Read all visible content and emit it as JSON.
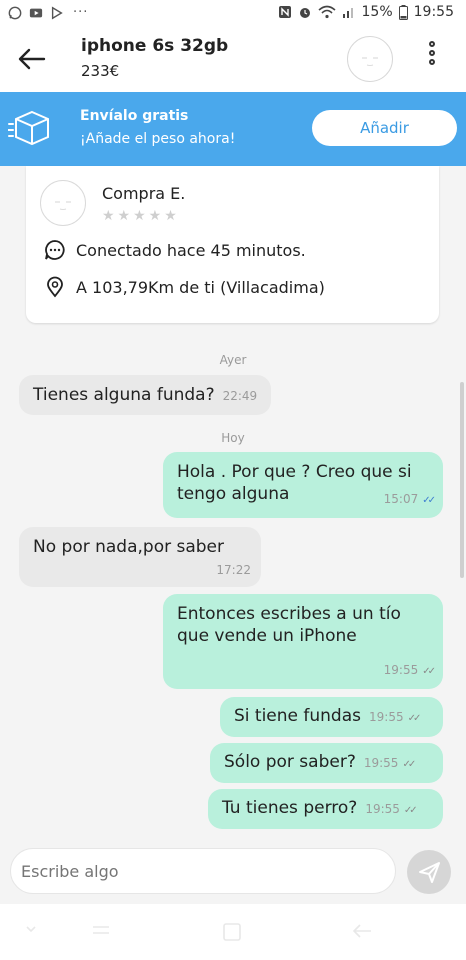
{
  "status_bar": {
    "notifications": [
      "whatsapp-icon",
      "youtube-icon",
      "play-store-icon"
    ],
    "more": "···",
    "battery": "15%",
    "time": "19:55"
  },
  "header": {
    "title": "iphone 6s 32gb",
    "price": "233€"
  },
  "banner": {
    "title": "Envíalo gratis",
    "subtitle": "¡Añade el peso ahora!",
    "button": "Añadir",
    "color": "#4aa8ec"
  },
  "seller": {
    "name": "Compra E.",
    "stars": "★★★★★",
    "last_seen": "Conectado hace 45 minutos.",
    "location": "A 103,79Km de ti (Villacadima)"
  },
  "chat": {
    "day_yesterday": "Ayer",
    "day_today": "Hoy",
    "messages": [
      {
        "text": "Tienes alguna funda?",
        "time": "22:49",
        "dir": "in"
      },
      {
        "text": "Hola . Por que ? Creo que si tengo alguna",
        "time": "15:07",
        "dir": "out"
      },
      {
        "text": "No por nada,por saber",
        "time": "17:22",
        "dir": "in"
      },
      {
        "text": "Entonces escribes a un tío que vende un iPhone",
        "time": "19:55",
        "dir": "out"
      },
      {
        "text": "Si tiene fundas",
        "time": "19:55",
        "dir": "out"
      },
      {
        "text": "Sólo por saber?",
        "time": "19:55",
        "dir": "out"
      },
      {
        "text": "Tu tienes perro?",
        "time": "19:55",
        "dir": "out"
      }
    ],
    "ticks": "✓✓",
    "incoming_color": "#e9e9e9",
    "outgoing_color": "#b9f0dc"
  },
  "composer": {
    "placeholder": "Escribe algo"
  }
}
